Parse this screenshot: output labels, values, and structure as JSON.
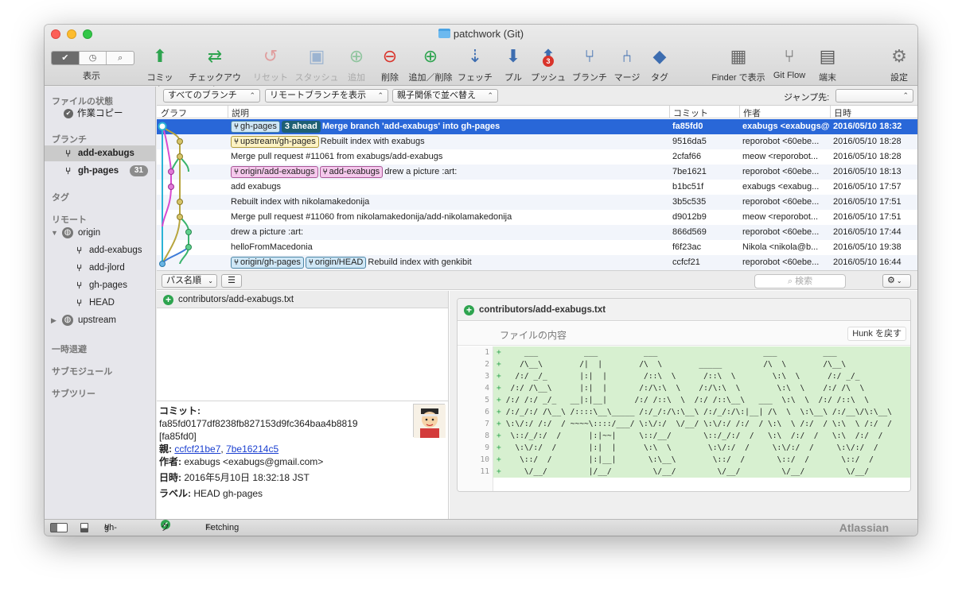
{
  "window": {
    "title": "patchwork (Git)"
  },
  "toolbar": {
    "view_label": "表示",
    "tools": [
      {
        "label": "コミット",
        "icon": "commit-icon"
      },
      {
        "label": "チェックアウト",
        "icon": "checkout-icon"
      },
      {
        "label": "リセット",
        "icon": "reset-icon"
      },
      {
        "label": "スタッシュ",
        "icon": "stash-icon"
      },
      {
        "label": "追加",
        "icon": "add-icon"
      },
      {
        "label": "削除",
        "icon": "remove-icon"
      },
      {
        "label": "追加／削除",
        "icon": "add-remove-icon"
      },
      {
        "label": "フェッチ",
        "icon": "fetch-icon"
      },
      {
        "label": "プル",
        "icon": "pull-icon"
      },
      {
        "label": "プッシュ",
        "icon": "push-icon",
        "badge": "3"
      },
      {
        "label": "ブランチ",
        "icon": "branch-icon"
      },
      {
        "label": "マージ",
        "icon": "merge-icon"
      },
      {
        "label": "タグ",
        "icon": "tag-icon"
      },
      {
        "label": "Finder で表示",
        "icon": "finder-icon"
      },
      {
        "label": "Git Flow",
        "icon": "git-flow-icon"
      },
      {
        "label": "端末",
        "icon": "terminal-icon"
      },
      {
        "label": "設定",
        "icon": "settings-icon"
      }
    ]
  },
  "sidebar": {
    "file_status_heading": "ファイルの状態",
    "working_copy": "作業コピー",
    "branches_heading": "ブランチ",
    "branches": [
      {
        "name": "add-exabugs",
        "selected": true
      },
      {
        "name": "gh-pages",
        "count": "31"
      }
    ],
    "tags_heading": "タグ",
    "remotes_heading": "リモート",
    "remote_origin": "origin",
    "origin_branches": [
      "add-exabugs",
      "add-jlord",
      "gh-pages",
      "HEAD"
    ],
    "remote_upstream": "upstream",
    "stashes_heading": "一時退避",
    "submodules_heading": "サブモジュール",
    "subtrees_heading": "サブツリー"
  },
  "filters": {
    "branches": "すべてのブランチ",
    "remote_branches": "リモートブランチを表示",
    "order": "親子関係で並べ替え",
    "jump_label": "ジャンプ先:"
  },
  "columns": {
    "graph": "グラフ",
    "description": "説明",
    "commit": "コミット",
    "author": "作者",
    "date": "日時"
  },
  "commits": [
    {
      "tags": [
        {
          "text": "gh-pages",
          "style": "blue"
        },
        {
          "text": "3 ahead",
          "style": "ahead"
        }
      ],
      "message": "Merge branch 'add-exabugs' into gh-pages",
      "hash": "fa85fd0",
      "author": "exabugs <exabugs@gmail.com>",
      "date": "2016/05/10 18:32"
    },
    {
      "tags": [
        {
          "text": "upstream/gh-pages",
          "style": "yel"
        }
      ],
      "message": "Rebuilt index with exabugs",
      "hash": "9516da5",
      "author": "reporobot <60ebe...",
      "date": "2016/05/10 18:28"
    },
    {
      "tags": [],
      "message": "Merge pull request #11061 from exabugs/add-exabugs",
      "hash": "2cfaf66",
      "author": "meow <reporobot...",
      "date": "2016/05/10 18:28"
    },
    {
      "tags": [
        {
          "text": "origin/add-exabugs",
          "style": "pink"
        },
        {
          "text": "add-exabugs",
          "style": "pink"
        }
      ],
      "message": "drew a picture :art:",
      "hash": "7be1621",
      "author": "reporobot <60ebe...",
      "date": "2016/05/10 18:13"
    },
    {
      "tags": [],
      "message": "add exabugs",
      "hash": "b1bc51f",
      "author": "exabugs <exabug...",
      "date": "2016/05/10 17:57"
    },
    {
      "tags": [],
      "message": "Rebuilt index with nikolamakedonija",
      "hash": "3b5c535",
      "author": "reporobot <60ebe...",
      "date": "2016/05/10 17:51"
    },
    {
      "tags": [],
      "message": "Merge pull request #11060 from nikolamakedonija/add-nikolamakedonija",
      "hash": "d9012b9",
      "author": "meow <reporobot...",
      "date": "2016/05/10 17:51"
    },
    {
      "tags": [],
      "message": "drew a picture :art:",
      "hash": "866d569",
      "author": "reporobot <60ebe...",
      "date": "2016/05/10 17:44"
    },
    {
      "tags": [],
      "message": "helloFromMacedonia",
      "hash": "f6f23ac",
      "author": "Nikola <nikola@b...",
      "date": "2016/05/10 19:38"
    },
    {
      "tags": [
        {
          "text": "origin/gh-pages",
          "style": "blue"
        },
        {
          "text": "origin/HEAD",
          "style": "blue"
        }
      ],
      "message": "Rebuild index with genkibit",
      "hash": "ccfcf21",
      "author": "reporobot <60ebe...",
      "date": "2016/05/10 16:44"
    }
  ],
  "lower_toolbar": {
    "path_sort": "パス名順",
    "search_placeholder": "検索"
  },
  "files": [
    {
      "name": "contributors/add-exabugs.txt",
      "status": "added"
    }
  ],
  "commit_info": {
    "commit_label": "コミット:",
    "full_hash": "fa85fd0177df8238fb827153d9fc364baa4b8819",
    "short_hash": "[fa85fd0]",
    "parents_label": "親:",
    "parent1": "ccfcf21be7",
    "parent2": "7be16214c5",
    "author_label": "作者:",
    "author": "exabugs <exabugs@gmail.com>",
    "date_label": "日時:",
    "date": "2016年5月10日 18:32:18 JST",
    "labels_label": "ラベル:",
    "labels": "HEAD gh-pages"
  },
  "diff": {
    "file": "contributors/add-exabugs.txt",
    "hunk_header": "ファイルの内容",
    "revert_hunk": "Hunk を戻す",
    "lines": [
      {
        "n": "1",
        "text": "    ___          ___          ___                       ___          ___"
      },
      {
        "n": "2",
        "text": "   /\\__\\        /|  |        /\\  \\        _____         /\\  \\        /\\__\\"
      },
      {
        "n": "3",
        "text": "  /:/ _/_       |:|  |        /::\\  \\      /::\\  \\        \\:\\  \\      /:/ _/_"
      },
      {
        "n": "4",
        "text": " /:/ /\\__\\      |:|  |       /:/\\:\\  \\    /:/\\:\\  \\        \\:\\  \\    /:/ /\\  \\"
      },
      {
        "n": "5",
        "text": "/:/ /:/ _/_   __|:|__|      /:/ /::\\  \\  /:/ /::\\__\\   ___  \\:\\  \\  /:/ /::\\  \\"
      },
      {
        "n": "6",
        "text": "/:/_/:/ /\\__\\ /::::\\__\\_____ /:/_/:/\\:\\__\\ /:/_/:/\\:|__| /\\  \\  \\:\\__\\ /:/__\\/\\:\\__\\"
      },
      {
        "n": "7",
        "text": "\\:\\/:/ /:/  / ~~~~\\::::/___/ \\:\\/:/  \\/__/ \\:\\/:/ /:/  / \\:\\  \\ /:/  / \\:\\  \\ /:/  /"
      },
      {
        "n": "8",
        "text": " \\::/_/:/  /      |:|~~|     \\::/__/       \\::/_/:/  /   \\:\\  /:/  /   \\:\\  /:/  /"
      },
      {
        "n": "9",
        "text": "  \\:\\/:/  /       |:|  |      \\:\\  \\        \\:\\/:/  /     \\:\\/:/  /     \\:\\/:/  /"
      },
      {
        "n": "10",
        "text": "   \\::/  /        |:|__|       \\:\\__\\        \\::/  /       \\::/  /       \\::/  /"
      },
      {
        "n": "11",
        "text": "    \\/__/         |/__/         \\/__/         \\/__/         \\/__/         \\/__/"
      }
    ]
  },
  "statusbar": {
    "branch": "gh-pages",
    "clean": "クリーン",
    "fetching": "Fetching",
    "brand": "Atlassian"
  }
}
